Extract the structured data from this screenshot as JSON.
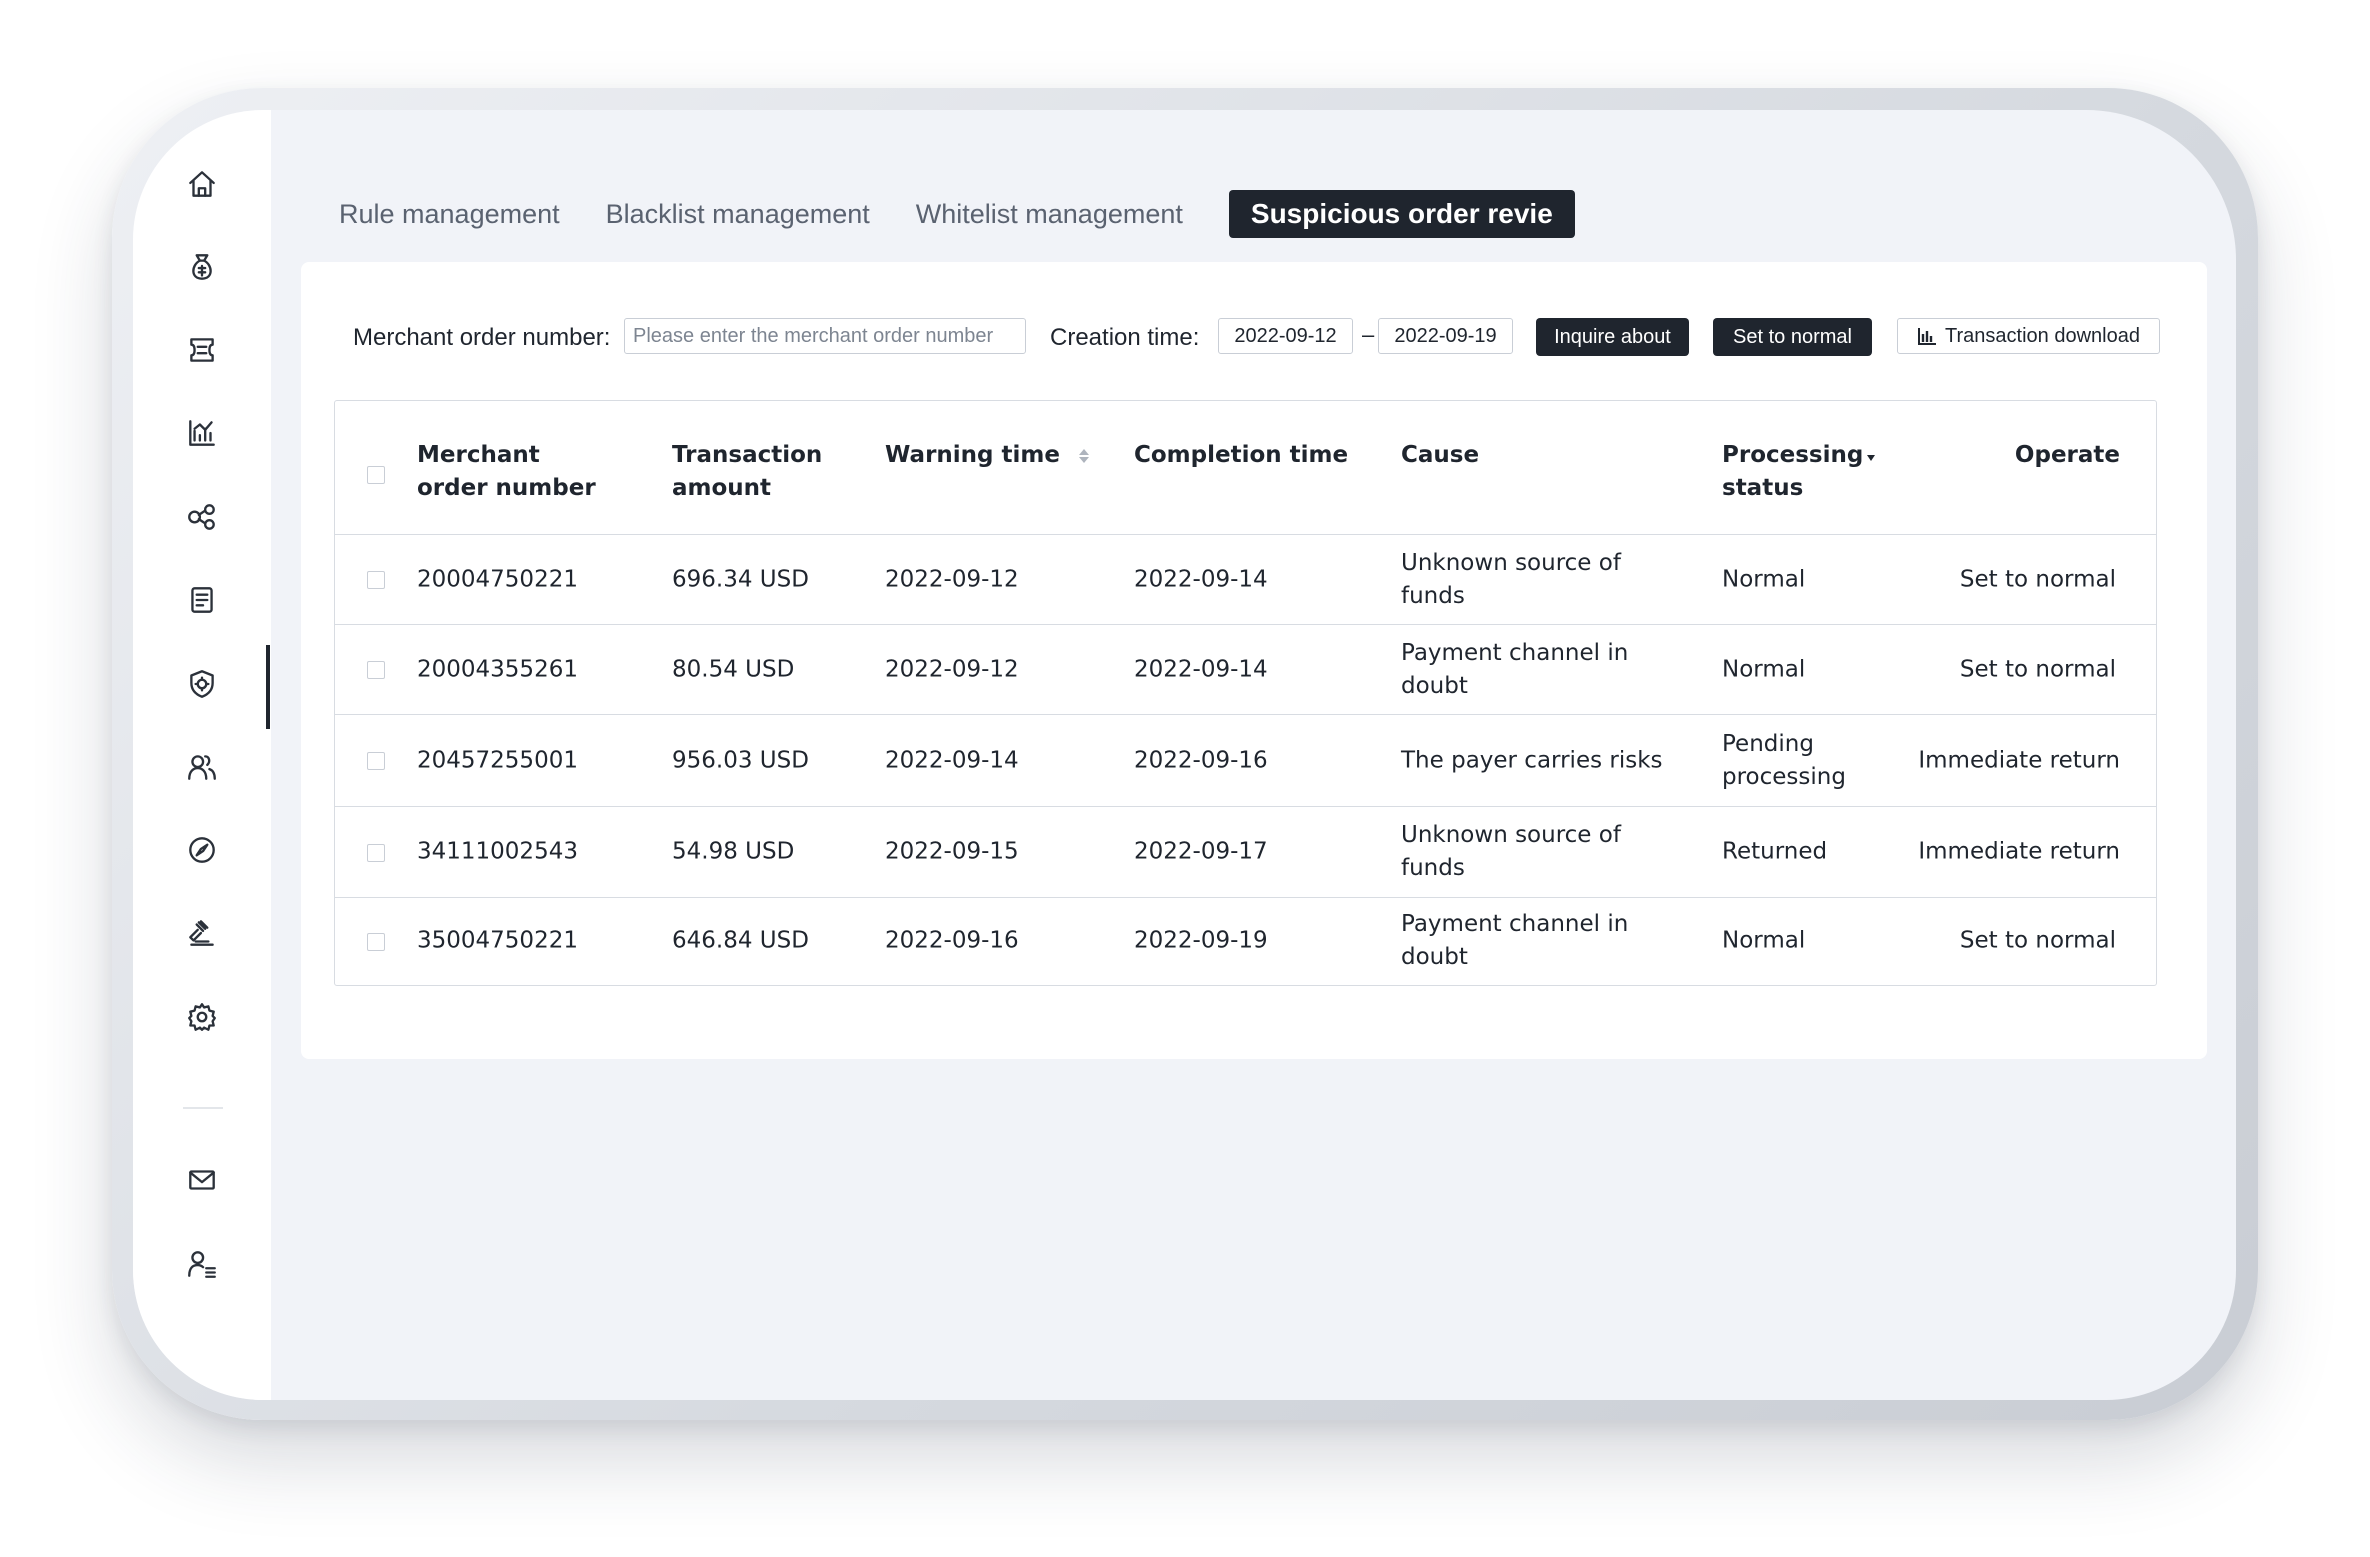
{
  "tabs": [
    {
      "label": "Rule management"
    },
    {
      "label": "Blacklist management"
    },
    {
      "label": "Whitelist management"
    },
    {
      "label": "Suspicious order revie",
      "active": true
    }
  ],
  "filter": {
    "order_label": "Merchant order number",
    "order_placeholder": "Please enter the merchant order number",
    "time_label": "Creation time",
    "date_from": "2022-09-12",
    "date_sep": "–",
    "date_to": "2022-09-19",
    "inquire_label": "Inquire about",
    "set_normal_label": "Set to normal",
    "download_label": "Transaction download"
  },
  "table": {
    "headers": [
      "Merchant order number",
      "Transaction amount",
      "Warning time",
      "Completion time",
      "Cause",
      "Processing status",
      "Operate"
    ],
    "rows": [
      {
        "order": "20004750221",
        "amount": "696.34 USD",
        "warning": "2022-09-12",
        "completion": "2022-09-14",
        "cause": "Unknown source of funds",
        "status": "Normal",
        "operate": "Set to normal"
      },
      {
        "order": "20004355261",
        "amount": "80.54 USD",
        "warning": "2022-09-12",
        "completion": "2022-09-14",
        "cause": "Payment channel in doubt",
        "status": "Normal",
        "operate": "Set to normal"
      },
      {
        "order": "20457255001",
        "amount": "956.03 USD",
        "warning": "2022-09-14",
        "completion": "2022-09-16",
        "cause": "The payer carries risks",
        "status": "Pending processing",
        "operate": "Immediate return"
      },
      {
        "order": "34111002543",
        "amount": "54.98 USD",
        "warning": "2022-09-15",
        "completion": "2022-09-17",
        "cause": "Unknown source of funds",
        "status": "Returned",
        "operate": "Immediate return"
      },
      {
        "order": "35004750221",
        "amount": "646.84 USD",
        "warning": "2022-09-16",
        "completion": "2022-09-19",
        "cause": "Payment channel in doubt",
        "status": "Normal",
        "operate": "Set to normal"
      }
    ]
  },
  "sidebar": {
    "icons": [
      "home-icon",
      "money-bag-icon",
      "ticket-icon",
      "chart-icon",
      "share-icon",
      "document-icon",
      "shield-icon",
      "users-icon",
      "compass-icon",
      "gavel-icon",
      "gear-icon",
      "mail-icon",
      "user-list-icon"
    ],
    "active": "shield-icon"
  },
  "colors": {
    "accent": "#1f252e",
    "background": "#f1f3f8",
    "border": "#d8dce2"
  }
}
